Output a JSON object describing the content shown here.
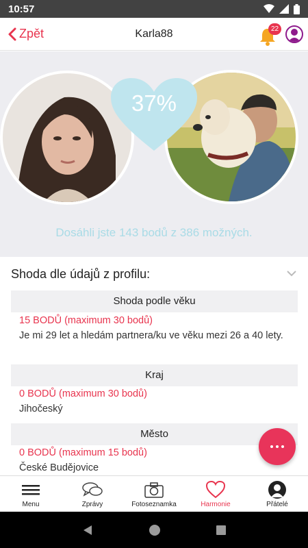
{
  "status_bar": {
    "time": "10:57"
  },
  "header": {
    "back_label": "Zpět",
    "title": "Karla88",
    "notification_count": "22"
  },
  "hero": {
    "percent": "37%",
    "points_text": "Dosáhli jste 143 bodů z 386 možných."
  },
  "section": {
    "title": "Shoda dle údajů z profilu:",
    "rows": [
      {
        "heading": "Shoda podle věku",
        "points": "15 BODŮ (maximum 30 bodů)",
        "description": "Je mi 29 let a hledám partnera/ku ve věku mezi 26 a 40 lety."
      },
      {
        "heading": "Kraj",
        "points": "0 BODŮ (maximum 30 bodů)",
        "description": "Jihočeský"
      },
      {
        "heading": "Město",
        "points": "0 BODŮ (maximum 15 bodů)",
        "description": "České Budějovice"
      }
    ]
  },
  "bottom_nav": {
    "items": [
      {
        "label": "Menu",
        "icon": "hamburger-icon"
      },
      {
        "label": "Zprávy",
        "icon": "chat-icon"
      },
      {
        "label": "Fotoseznamka",
        "icon": "camera-icon"
      },
      {
        "label": "Harmonie",
        "icon": "heart-icon",
        "active": true
      },
      {
        "label": "Přátelé",
        "icon": "friends-icon"
      }
    ]
  },
  "colors": {
    "accent": "#e8344e",
    "heart": "#bfe5ee",
    "hero_bg": "#ededf1",
    "points_text": "#a9dbe6"
  }
}
